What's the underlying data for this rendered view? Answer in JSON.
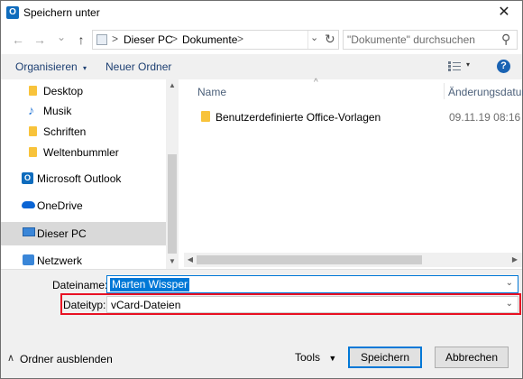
{
  "window": {
    "title": "Speichern unter",
    "app_icon": "outlook-icon",
    "close_glyph": "✕"
  },
  "nav": {
    "back_glyph": "←",
    "forward_glyph": "→",
    "recent_glyph": "⌄",
    "up_glyph": "↑",
    "breadcrumb": [
      "Dieser PC",
      "Dokumente"
    ],
    "separator": ">",
    "refresh_glyph": "↻",
    "search_placeholder": "\"Dokumente\" durchsuchen",
    "search_glyph": "⚲"
  },
  "toolbar": {
    "organize_label": "Organisieren",
    "organize_arrow": "▾",
    "new_folder_label": "Neuer Ordner",
    "view_arrow": "▾",
    "help_label": "?"
  },
  "sidebar": {
    "items": [
      {
        "label": "Desktop",
        "icon": "folder-icon"
      },
      {
        "label": "Musik",
        "icon": "music-icon"
      },
      {
        "label": "Schriften",
        "icon": "folder-icon"
      },
      {
        "label": "Weltenbummler",
        "icon": "folder-icon"
      },
      {
        "label": "Microsoft Outlook",
        "icon": "outlook-icon"
      },
      {
        "label": "OneDrive",
        "icon": "cloud-icon"
      },
      {
        "label": "Dieser PC",
        "icon": "computer-icon",
        "selected": true
      },
      {
        "label": "Netzwerk",
        "icon": "network-icon"
      }
    ]
  },
  "file_list": {
    "columns": [
      "Name",
      "Änderungsdatum"
    ],
    "sort_glyph": "^",
    "rows": [
      {
        "name": "Benutzerdefinierte Office-Vorlagen",
        "date": "09.11.19 08:16",
        "icon": "folder-icon"
      }
    ]
  },
  "form": {
    "filename_label": "Dateiname:",
    "filename_value": "Marten Wissper",
    "filetype_label": "Dateityp:",
    "filetype_value": "vCard-Dateien",
    "dropdown_glyph": "⌄"
  },
  "footer": {
    "hide_folders_glyph": "∧",
    "hide_folders_label": "Ordner ausblenden",
    "tools_label": "Tools",
    "tools_arrow": "▼",
    "save_label": "Speichern",
    "cancel_label": "Abbrechen"
  },
  "colors": {
    "accent": "#0078d7",
    "highlight_border": "#e81123",
    "folder": "#f8c33b",
    "toolbar_text": "#1d3f72"
  }
}
